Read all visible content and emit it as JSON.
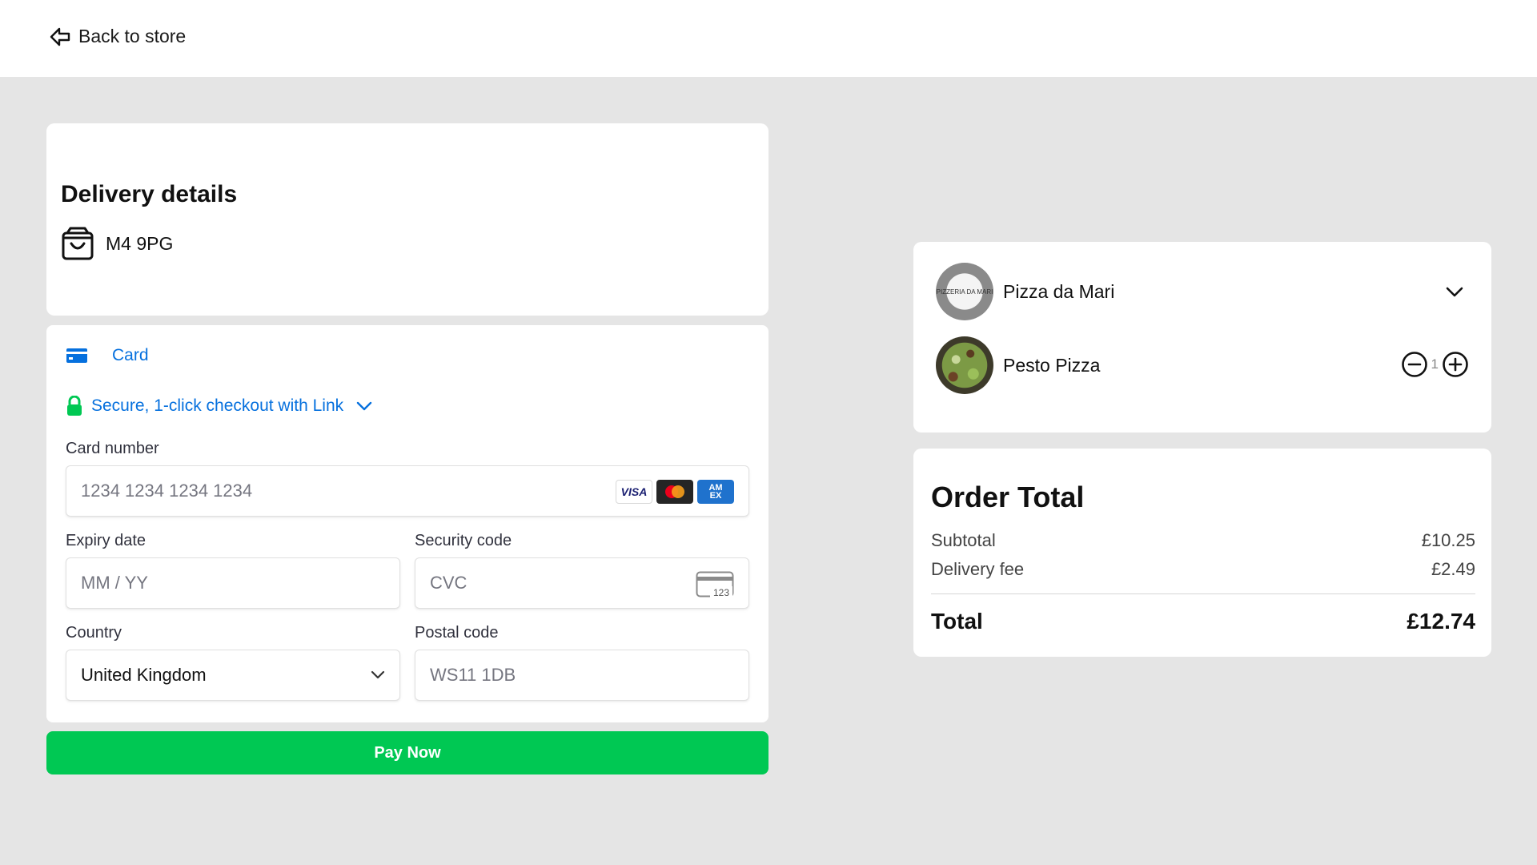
{
  "header": {
    "back_label": "Back to store"
  },
  "delivery": {
    "title": "Delivery details",
    "address": "M4 9PG"
  },
  "payment": {
    "method_tab": "Card",
    "link_text": "Secure, 1-click checkout with Link",
    "card_number": {
      "label": "Card number",
      "placeholder": "1234 1234 1234 1234",
      "brands": [
        "VISA",
        "Mastercard",
        "AMEX"
      ]
    },
    "expiry": {
      "label": "Expiry date",
      "placeholder": "MM / YY"
    },
    "security": {
      "label": "Security code",
      "placeholder": "CVC",
      "icon_text": "123"
    },
    "country": {
      "label": "Country",
      "value": "United Kingdom"
    },
    "postal": {
      "label": "Postal code",
      "placeholder": "WS11 1DB"
    },
    "pay_button": "Pay Now"
  },
  "cart": {
    "store_name": "Pizza da Mari",
    "store_logo_text": "PIZZERIA DA MARI",
    "items": [
      {
        "name": "Pesto Pizza",
        "quantity": "1"
      }
    ]
  },
  "order_total": {
    "heading": "Order Total",
    "subtotal_label": "Subtotal",
    "subtotal_value": "£10.25",
    "delivery_label": "Delivery fee",
    "delivery_value": "£2.49",
    "total_label": "Total",
    "total_value": "£12.74"
  },
  "colors": {
    "accent_blue": "#0570de",
    "pay_green": "#00c853",
    "page_bg": "#e5e5e5",
    "link_lock_green": "#00c853"
  },
  "icons": {
    "back": "arrow-left-outline-icon",
    "delivery": "shopping-bag-icon",
    "card": "credit-card-icon",
    "lock": "lock-icon",
    "cvc": "card-cvc-icon",
    "minus": "minus-circle-icon",
    "plus": "plus-circle-icon"
  }
}
